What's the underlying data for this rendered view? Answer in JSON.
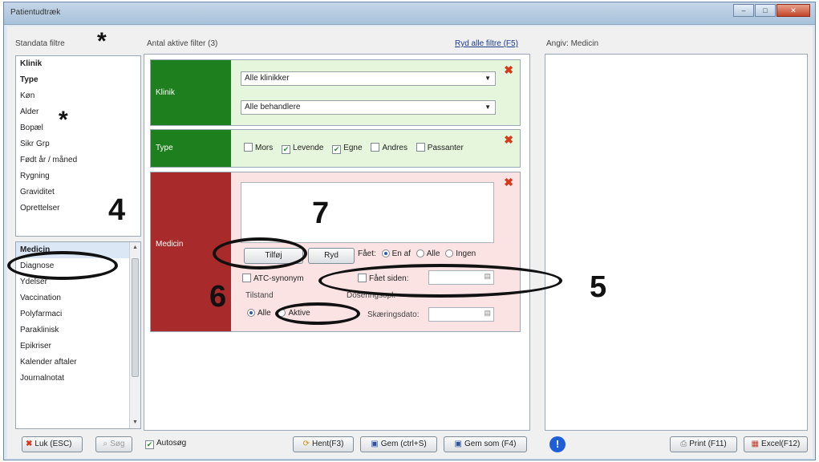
{
  "window": {
    "title": "Patientudtræk",
    "controls": {
      "minimize": "–",
      "maximize": "□",
      "close": "✕"
    }
  },
  "left": {
    "standard_title": "Standata filtre",
    "standard_items": [
      "Klinik",
      "Type",
      "Køn",
      "Alder",
      "Bopæl",
      "Sikr Grp",
      "Født år / måned",
      "Rygning",
      "Graviditet",
      "Oprettelser"
    ],
    "second_items": [
      "Medicin",
      "Diagnose",
      "Ydelser",
      "Vaccination",
      "Polyfarmaci",
      "Paraklinisk",
      "Epikriser",
      "Kalender aftaler",
      "Journalnotat"
    ]
  },
  "middle": {
    "active_count_label": "Antal aktive filter (3)",
    "clear_all_link": "Ryd alle filtre (F5)",
    "klinik": {
      "label": "Klinik",
      "select1": "Alle klinikker",
      "select2": "Alle behandlere"
    },
    "type": {
      "label": "Type",
      "options": [
        {
          "label": "Mors",
          "checked": false
        },
        {
          "label": "Levende",
          "checked": true
        },
        {
          "label": "Egne",
          "checked": true
        },
        {
          "label": "Andres",
          "checked": false
        },
        {
          "label": "Passanter",
          "checked": false
        }
      ]
    },
    "medicin": {
      "label": "Medicin",
      "add_button": "Tilføj",
      "clear_button": "Ryd",
      "faaet_label": "Fået:",
      "radio_en_af": "En af",
      "radio_alle": "Alle",
      "radio_ingen": "Ingen",
      "atc_label": "ATC-synonym",
      "faaet_siden_label": "Fået siden:",
      "tilstand_label": "Tilstand",
      "tilstand_alle": "Alle",
      "tilstand_aktive": "Aktive",
      "doseringsopl_label": "Doseringsopl.",
      "skaeringsdato_label": "Skæringsdato:"
    }
  },
  "right": {
    "title": "Angiv: Medicin"
  },
  "footer": {
    "close_button": "Luk (ESC)",
    "search_button": "Søg",
    "autosearch_label": "Autosøg",
    "fetch_button": "Hent(F3)",
    "save_button": "Gem (ctrl+S)",
    "save_as_button": "Gem som (F4)",
    "print_button": "Print (F11)",
    "excel_button": "Excel(F12)"
  },
  "annotations": {
    "asterisk_top": "*",
    "asterisk_alder": "*",
    "num4": "4",
    "num5": "5",
    "num6": "6",
    "num7": "7"
  },
  "colors": {
    "klinik_green": "#1d7f1d",
    "type_green": "#1d7f1d",
    "medicin_red": "#a82a2a",
    "filter_bg_green": "#e6f6dd",
    "filter_bg_red": "#fbe3e3"
  }
}
